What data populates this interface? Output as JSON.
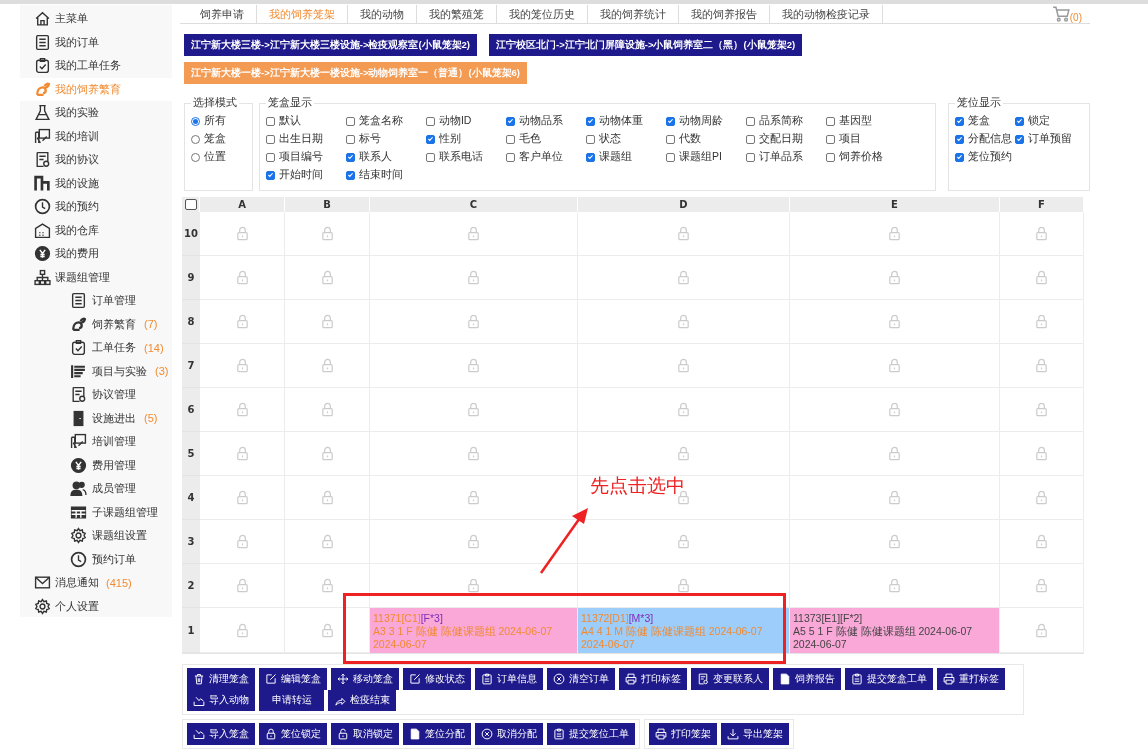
{
  "sidebar": {
    "items": [
      {
        "label": "主菜单",
        "selected": false
      },
      {
        "label": "我的订单",
        "selected": false
      },
      {
        "label": "我的工单任务",
        "selected": false
      },
      {
        "label": "我的饲养繁育",
        "selected": true
      },
      {
        "label": "我的实验",
        "selected": false
      },
      {
        "label": "我的培训",
        "selected": false
      },
      {
        "label": "我的协议",
        "selected": false
      },
      {
        "label": "我的设施",
        "selected": false
      },
      {
        "label": "我的预约",
        "selected": false
      },
      {
        "label": "我的仓库",
        "selected": false
      },
      {
        "label": "我的费用",
        "selected": false
      },
      {
        "label": "课题组管理",
        "selected": false,
        "children": [
          {
            "label": "订单管理",
            "selected": false
          },
          {
            "label": "饲养繁育",
            "selected": false,
            "count": "(7)"
          },
          {
            "label": "工单任务",
            "selected": false,
            "count": "(14)"
          },
          {
            "label": "项目与实验",
            "selected": false,
            "count": "(3)"
          },
          {
            "label": "协议管理",
            "selected": false
          },
          {
            "label": "设施进出",
            "selected": false,
            "count": "(5)"
          },
          {
            "label": "培训管理",
            "selected": false
          },
          {
            "label": "费用管理",
            "selected": false
          },
          {
            "label": "成员管理",
            "selected": false
          },
          {
            "label": "子课题组管理",
            "selected": false
          },
          {
            "label": "课题组设置",
            "selected": false
          },
          {
            "label": "预约订单",
            "selected": false
          }
        ]
      },
      {
        "label": "消息通知",
        "selected": false,
        "count": "(415)"
      },
      {
        "label": "个人设置",
        "selected": false
      }
    ]
  },
  "tabs": [
    {
      "label": "饲养申请",
      "selected": false
    },
    {
      "label": "我的饲养笼架",
      "selected": true
    },
    {
      "label": "我的动物",
      "selected": false
    },
    {
      "label": "我的繁殖笼",
      "selected": false
    },
    {
      "label": "我的笼位历史",
      "selected": false
    },
    {
      "label": "我的饲养统计",
      "selected": false
    },
    {
      "label": "我的饲养报告",
      "selected": false
    },
    {
      "label": "我的动物检疫记录",
      "selected": false
    }
  ],
  "cart": {
    "count": "(0)"
  },
  "racks": [
    {
      "label": "江宁新大楼三楼->江宁新大楼三楼设施->检疫观察室(小鼠笼架2)",
      "selected": false
    },
    {
      "label": "江宁校区北门->江宁北门屏障设施->小鼠饲养室二（黑）(小鼠笼架2)",
      "selected": false
    },
    {
      "label": "江宁新大楼一楼->江宁新大楼一楼设施->动物饲养室一（普通）(小鼠笼架6)",
      "selected": true
    }
  ],
  "select_mode": {
    "title": "选择模式",
    "options": [
      {
        "label": "所有",
        "selected": true
      },
      {
        "label": "笼盒",
        "selected": false
      },
      {
        "label": "位置",
        "selected": false
      }
    ]
  },
  "box_display": {
    "title": "笼盒显示",
    "options": [
      {
        "label": "默认",
        "checked": false
      },
      {
        "label": "笼盒名称",
        "checked": false
      },
      {
        "label": "动物ID",
        "checked": false
      },
      {
        "label": "动物品系",
        "checked": true
      },
      {
        "label": "动物体重",
        "checked": true
      },
      {
        "label": "动物周龄",
        "checked": true
      },
      {
        "label": "品系简称",
        "checked": false
      },
      {
        "label": "基因型",
        "checked": false
      },
      {
        "label": "出生日期",
        "checked": false
      },
      {
        "label": "标号",
        "checked": false
      },
      {
        "label": "性别",
        "checked": true
      },
      {
        "label": "毛色",
        "checked": false
      },
      {
        "label": "状态",
        "checked": false
      },
      {
        "label": "代数",
        "checked": false
      },
      {
        "label": "交配日期",
        "checked": false
      },
      {
        "label": "项目",
        "checked": false
      },
      {
        "label": "项目编号",
        "checked": false
      },
      {
        "label": "联系人",
        "checked": true
      },
      {
        "label": "联系电话",
        "checked": false
      },
      {
        "label": "客户单位",
        "checked": false
      },
      {
        "label": "课题组",
        "checked": true
      },
      {
        "label": "课题组PI",
        "checked": false
      },
      {
        "label": "订单品系",
        "checked": false
      },
      {
        "label": "饲养价格",
        "checked": false
      },
      {
        "label": "开始时间",
        "checked": true
      },
      {
        "label": "结束时间",
        "checked": true
      }
    ]
  },
  "slot_display": {
    "title": "笼位显示",
    "options": [
      {
        "label": "笼盒",
        "checked": true
      },
      {
        "label": "锁定",
        "checked": true
      },
      {
        "label": "分配信息",
        "checked": true
      },
      {
        "label": "订单预留",
        "checked": true
      },
      {
        "label": "笼位预约",
        "checked": true
      }
    ]
  },
  "grid": {
    "select_all": {
      "checked": false
    },
    "columns": [
      "A",
      "B",
      "C",
      "D",
      "E",
      "F"
    ],
    "rows": [
      {
        "label": "10",
        "cells": [
          {
            "kind": "empty"
          },
          {
            "kind": "empty"
          },
          {
            "kind": "empty"
          },
          {
            "kind": "empty"
          },
          {
            "kind": "empty"
          },
          {
            "kind": "empty"
          }
        ]
      },
      {
        "label": "9",
        "cells": [
          {
            "kind": "empty"
          },
          {
            "kind": "empty"
          },
          {
            "kind": "empty"
          },
          {
            "kind": "empty"
          },
          {
            "kind": "empty"
          },
          {
            "kind": "empty"
          }
        ]
      },
      {
        "label": "8",
        "cells": [
          {
            "kind": "empty"
          },
          {
            "kind": "empty"
          },
          {
            "kind": "empty"
          },
          {
            "kind": "empty"
          },
          {
            "kind": "empty"
          },
          {
            "kind": "empty"
          }
        ]
      },
      {
        "label": "7",
        "cells": [
          {
            "kind": "empty"
          },
          {
            "kind": "empty"
          },
          {
            "kind": "empty"
          },
          {
            "kind": "empty"
          },
          {
            "kind": "empty"
          },
          {
            "kind": "empty"
          }
        ]
      },
      {
        "label": "6",
        "cells": [
          {
            "kind": "empty"
          },
          {
            "kind": "empty"
          },
          {
            "kind": "empty"
          },
          {
            "kind": "empty"
          },
          {
            "kind": "empty"
          },
          {
            "kind": "empty"
          }
        ]
      },
      {
        "label": "5",
        "cells": [
          {
            "kind": "empty"
          },
          {
            "kind": "empty"
          },
          {
            "kind": "empty"
          },
          {
            "kind": "empty"
          },
          {
            "kind": "empty"
          },
          {
            "kind": "empty"
          }
        ]
      },
      {
        "label": "4",
        "cells": [
          {
            "kind": "empty"
          },
          {
            "kind": "empty"
          },
          {
            "kind": "empty"
          },
          {
            "kind": "empty"
          },
          {
            "kind": "empty"
          },
          {
            "kind": "empty"
          }
        ]
      },
      {
        "label": "3",
        "cells": [
          {
            "kind": "empty"
          },
          {
            "kind": "empty"
          },
          {
            "kind": "empty"
          },
          {
            "kind": "empty"
          },
          {
            "kind": "empty"
          },
          {
            "kind": "empty"
          }
        ]
      },
      {
        "label": "2",
        "cells": [
          {
            "kind": "empty"
          },
          {
            "kind": "empty"
          },
          {
            "kind": "empty"
          },
          {
            "kind": "empty"
          },
          {
            "kind": "empty"
          },
          {
            "kind": "empty"
          }
        ]
      },
      {
        "label": "1",
        "cells": [
          {
            "kind": "empty"
          },
          {
            "kind": "empty"
          },
          {
            "kind": "cage",
            "code": "11371[C1]",
            "tag": "[F*3]",
            "detail": "A3 3 1 F 陈健 陈健课题组 2024-06-07 2024-06-07",
            "color": "#f9a8d8",
            "selected": true
          },
          {
            "kind": "cage",
            "code": "11372[D1]",
            "tag": "[M*3]",
            "detail": "A4 4 1 M 陈健 陈健课题组 2024-06-07 2024-06-07",
            "color": "#9dcdfa",
            "selected": true
          },
          {
            "kind": "cage",
            "code": "11373[E1]",
            "tag": "[F*2]",
            "detail": "A5 5 1 F 陈健 陈健课题组 2024-06-07 2024-06-07",
            "color": "#f9a8d8",
            "selected": false
          },
          {
            "kind": "empty"
          }
        ]
      }
    ]
  },
  "annotation": {
    "text": "先点击选中"
  },
  "action_groups": [
    {
      "rows": [
        [
          "清理笼盒",
          "编辑笼盒",
          "移动笼盒",
          "修改状态",
          "订单信息",
          "清空订单",
          "打印标签",
          "变更联系人",
          "饲养报告",
          "提交笼盒工单",
          "重打标签"
        ],
        [
          "导入动物",
          "申请转运",
          "检疫结束"
        ]
      ]
    },
    {
      "rows": [
        [
          "导入笼盒",
          "笼位锁定",
          "取消锁定",
          "笼位分配",
          "取消分配",
          "提交笼位工单"
        ]
      ]
    },
    {
      "rows": [
        [
          "打印笼架",
          "导出笼架"
        ]
      ]
    }
  ]
}
